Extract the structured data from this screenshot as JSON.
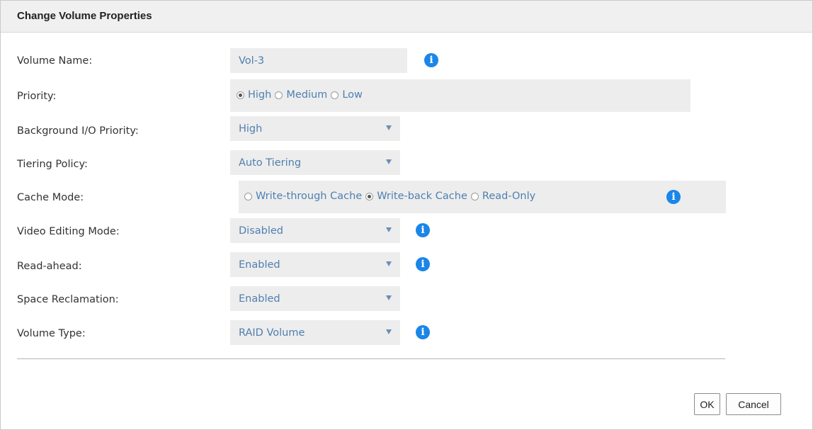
{
  "dialog": {
    "title": "Change Volume Properties"
  },
  "fields": {
    "volume_name": {
      "label": "Volume Name:",
      "value": "Vol-3"
    },
    "priority": {
      "label": "Priority:",
      "options": [
        "High",
        "Medium",
        "Low"
      ],
      "selected": "High"
    },
    "background_io_priority": {
      "label": "Background I/O Priority:",
      "value": "High"
    },
    "tiering_policy": {
      "label": "Tiering Policy:",
      "value": "Auto Tiering"
    },
    "cache_mode": {
      "label": "Cache Mode:",
      "options": [
        "Write-through Cache",
        "Write-back Cache",
        "Read-Only"
      ],
      "selected": "Write-back Cache"
    },
    "video_editing_mode": {
      "label": "Video Editing Mode:",
      "value": "Disabled"
    },
    "read_ahead": {
      "label": "Read-ahead:",
      "value": "Enabled"
    },
    "space_reclamation": {
      "label": "Space Reclamation:",
      "value": "Enabled"
    },
    "volume_type": {
      "label": "Volume Type:",
      "value": "RAID Volume"
    }
  },
  "icons": {
    "info": "info-icon",
    "info_glyph": "i",
    "dropdown": "caret-down-icon"
  },
  "buttons": {
    "ok": "OK",
    "cancel": "Cancel"
  },
  "colors": {
    "accent": "#1a86e8",
    "value_text": "#4f7fb0",
    "field_bg": "#ededed"
  }
}
